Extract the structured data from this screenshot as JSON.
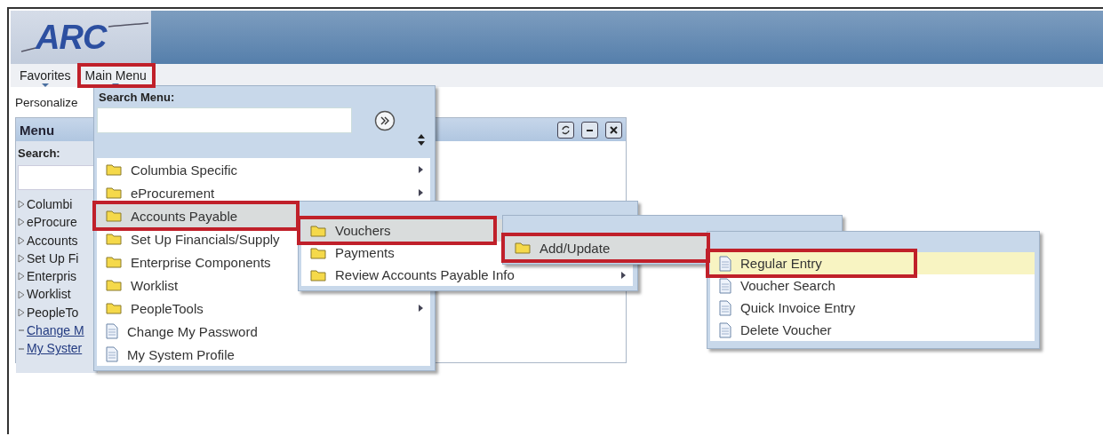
{
  "header": {
    "logo": "ARC"
  },
  "nav": [
    {
      "label": "Favorites"
    },
    {
      "label": "Main Menu",
      "annotated": true
    }
  ],
  "personalize": "Personalize",
  "pagelet": {
    "title": "Menu",
    "search_label": "Search:",
    "tree": [
      {
        "label": "Columbi",
        "kind": "folder"
      },
      {
        "label": "eProcure",
        "kind": "folder"
      },
      {
        "label": "Accounts",
        "kind": "folder"
      },
      {
        "label": "Set Up Fi",
        "kind": "folder"
      },
      {
        "label": "Enterpris",
        "kind": "folder"
      },
      {
        "label": "Worklist",
        "kind": "folder"
      },
      {
        "label": "PeopleTo",
        "kind": "folder"
      },
      {
        "label": "Change M",
        "kind": "link"
      },
      {
        "label": "My Syster",
        "kind": "link"
      }
    ]
  },
  "main_menu": {
    "search_label": "Search Menu:",
    "items": [
      {
        "label": "Columbia Specific",
        "kind": "folder",
        "submenu": true,
        "selected": false,
        "annotated": false
      },
      {
        "label": "eProcurement",
        "kind": "folder",
        "submenu": true,
        "selected": false,
        "annotated": false
      },
      {
        "label": "Accounts Payable",
        "kind": "folder",
        "selected": true,
        "annotated": true
      },
      {
        "label": "Set Up Financials/Supply",
        "kind": "folder",
        "selected": false,
        "annotated": false
      },
      {
        "label": "Enterprise Components",
        "kind": "folder",
        "selected": false,
        "annotated": false
      },
      {
        "label": "Worklist",
        "kind": "folder",
        "selected": false,
        "annotated": false
      },
      {
        "label": "PeopleTools",
        "kind": "folder",
        "submenu": true,
        "selected": false,
        "annotated": false
      },
      {
        "label": "Change My Password",
        "kind": "page",
        "selected": false,
        "annotated": false
      },
      {
        "label": "My System Profile",
        "kind": "page",
        "selected": false,
        "annotated": false
      }
    ]
  },
  "flyouts": [
    {
      "items": [
        {
          "label": "Vouchers",
          "kind": "folder",
          "selected": true,
          "annotated": true
        },
        {
          "label": "Payments",
          "kind": "folder",
          "selected": false,
          "annotated": false
        },
        {
          "label": "Review Accounts Payable Info",
          "kind": "folder",
          "submenu": true,
          "selected": false,
          "annotated": false
        }
      ]
    },
    {
      "items": [
        {
          "label": "Add/Update",
          "kind": "folder",
          "selected": true,
          "annotated": true
        }
      ]
    },
    {
      "items": [
        {
          "label": "Regular Entry",
          "kind": "page",
          "selected": true,
          "annotated": true
        },
        {
          "label": "Voucher Search",
          "kind": "page",
          "selected": false,
          "annotated": false
        },
        {
          "label": "Quick Invoice Entry",
          "kind": "page",
          "selected": false,
          "annotated": false
        },
        {
          "label": "Delete Voucher",
          "kind": "page",
          "selected": false,
          "annotated": false
        }
      ]
    }
  ]
}
